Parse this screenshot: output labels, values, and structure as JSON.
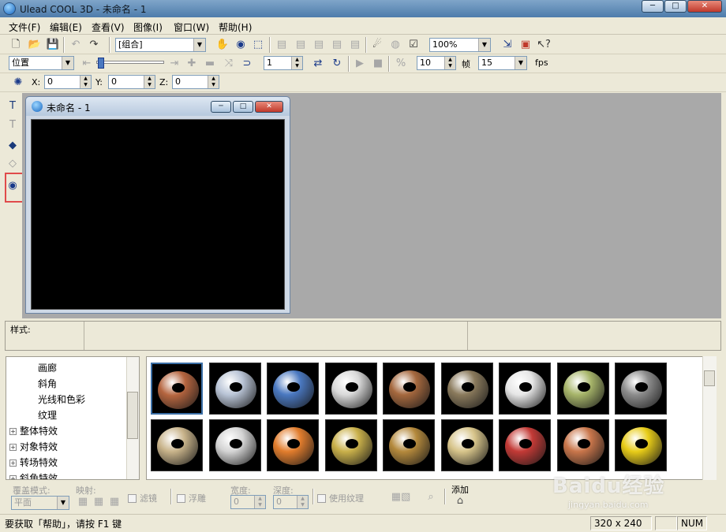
{
  "window": {
    "title": "Ulead COOL 3D - 未命名 - 1"
  },
  "menu": [
    "文件(F)",
    "编辑(E)",
    "查看(V)",
    "图像(I)",
    "窗口(W)",
    "帮助(H)"
  ],
  "toolbar1": {
    "object_combo": "[组合]",
    "zoom_combo": "100%"
  },
  "toolbar2": {
    "mode_combo": "位置",
    "frame_value": "1",
    "frames_value": "10",
    "frames_label": "帧",
    "fps_value": "15",
    "fps_label": "fps"
  },
  "toolbar3": {
    "x_label": "X:",
    "x_value": "0",
    "y_label": "Y:",
    "y_value": "0",
    "z_label": "Z:",
    "z_value": "0"
  },
  "document": {
    "title": "未命名 - 1"
  },
  "style_panel": {
    "label": "样式:"
  },
  "tree": {
    "items": [
      {
        "label": "画廊",
        "expandable": false
      },
      {
        "label": "斜角",
        "expandable": false
      },
      {
        "label": "光线和色彩",
        "expandable": false
      },
      {
        "label": "纹理",
        "expandable": false
      },
      {
        "label": "整体特效",
        "expandable": true
      },
      {
        "label": "对象特效",
        "expandable": true
      },
      {
        "label": "转场特效",
        "expandable": true
      },
      {
        "label": "斜角特效",
        "expandable": true
      }
    ]
  },
  "gallery": {
    "tiles": [
      {
        "name": "brick-red",
        "color": "#b5653f"
      },
      {
        "name": "silver-pattern",
        "color": "#b9c4d6"
      },
      {
        "name": "blue-stone",
        "color": "#4a78c0"
      },
      {
        "name": "white-brick",
        "color": "#d9d9d9"
      },
      {
        "name": "wood-brick",
        "color": "#a5683e"
      },
      {
        "name": "rock-brown",
        "color": "#8a7a5c"
      },
      {
        "name": "crackle-white",
        "color": "#e6e6e6"
      },
      {
        "name": "green-moss",
        "color": "#a7b56a"
      },
      {
        "name": "grey-stone",
        "color": "#8c8c8c"
      },
      {
        "name": "burlap",
        "color": "#c8b38a"
      },
      {
        "name": "chrome",
        "color": "#d4d4d4"
      },
      {
        "name": "orange-clay",
        "color": "#e27d2d"
      },
      {
        "name": "gold-metal",
        "color": "#c9b04a"
      },
      {
        "name": "brass",
        "color": "#b4893c"
      },
      {
        "name": "pale-gold",
        "color": "#d7c48a"
      },
      {
        "name": "red-brick",
        "color": "#c33a36"
      },
      {
        "name": "terracotta-brick",
        "color": "#c9764b"
      },
      {
        "name": "yellow-glossy",
        "color": "#e8cc18"
      }
    ]
  },
  "attributes": {
    "overlay_label": "覆盖模式:",
    "overlay_value": "平面",
    "mapping_label": "映射:",
    "filter_label": "滤镜",
    "emboss_label": "浮雕",
    "width_label": "宽度:",
    "width_value": "0",
    "depth_label": "深度:",
    "depth_value": "0",
    "use_texture_label": "使用纹理",
    "add_label": "添加"
  },
  "status": {
    "help_text": "要获取「帮助」，请按 F1 键",
    "canvas_size": "320 x 240",
    "num": "NUM"
  },
  "watermark": {
    "logo": "Baidu经验",
    "url": "jingyan.baidu.com"
  },
  "colors": {
    "accent_red": "#e04b4b",
    "canvas": "#000000",
    "workspace": "#a9a9a9"
  }
}
